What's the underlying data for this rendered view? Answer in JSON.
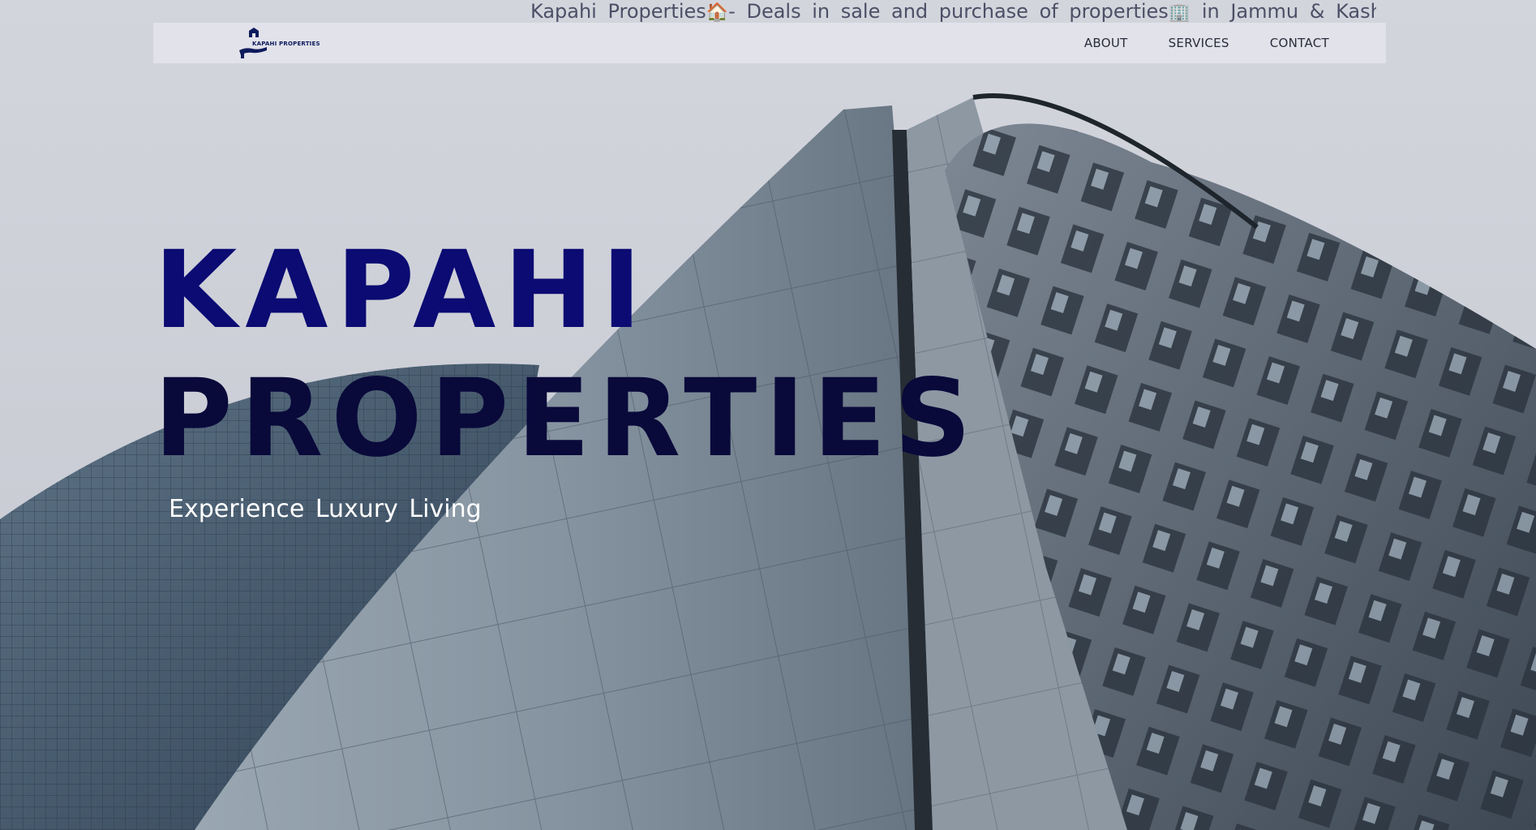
{
  "banner": {
    "text_part1": "Kapahi Properties",
    "emoji_house": "🏠",
    "text_part2": "- Deals in sale and purchase of properties",
    "emoji_building": "🏢",
    "text_part3": " in Jammu & Kashmir"
  },
  "navbar": {
    "logo_text": "KAPAHI PROPERTIES",
    "logo_icon": "house-hand-icon",
    "links": [
      {
        "label": "ABOUT"
      },
      {
        "label": "SERVICES"
      },
      {
        "label": "CONTACT"
      }
    ]
  },
  "hero": {
    "title_line1": "KAPAHI",
    "title_line2": "PROPERTIES",
    "tagline": "Experience Luxury Living",
    "background": "skyscrapers-photo"
  },
  "colors": {
    "title_primary": "#0b0b73",
    "title_secondary": "#09093a",
    "banner_text": "#4d4f66",
    "nav_text": "#2a2c3a",
    "tagline": "#ffffff"
  }
}
